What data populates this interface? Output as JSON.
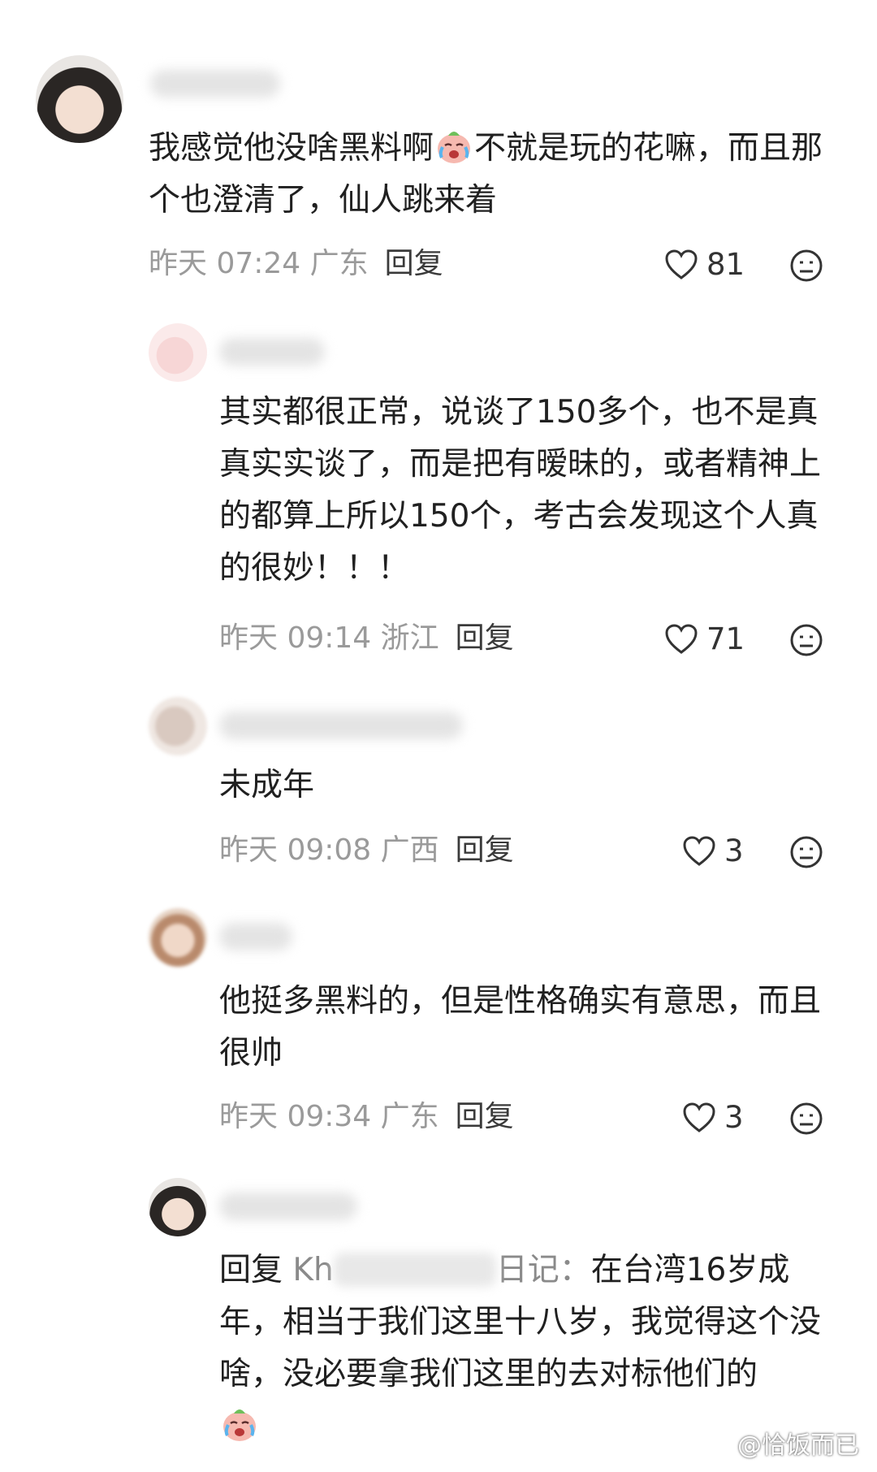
{
  "comments": [
    {
      "text_before": "我感觉他没啥黑料啊",
      "emoji_icon": "crying-laughing-emoji",
      "text_after": "不就是玩的花嘛，而且那个也澄清了，仙人跳来着",
      "meta": "昨天 07:24 广东",
      "reply_label": "回复",
      "likes": "81"
    },
    {
      "text": "其实都很正常，说谈了150多个，也不是真真实实谈了，而是把有暧昧的，或者精神上的都算上所以150个，考古会发现这个人真的很妙！！！",
      "meta": "昨天 09:14 浙江",
      "reply_label": "回复",
      "likes": "71"
    },
    {
      "text": "未成年",
      "meta": "昨天 09:08 广西",
      "reply_label": "回复",
      "likes": "3"
    },
    {
      "text": "他挺多黑料的，但是性格确实有意思，而且很帅",
      "meta": "昨天 09:34 广东",
      "reply_label": "回复",
      "likes": "3"
    },
    {
      "reply_prefix": "回复",
      "mention_visible": "Kh",
      "mention_tail": "日记：",
      "text": "在台湾16岁成年，相当于我们这里十八岁，我觉得这个没啥，没必要拿我们这里的去对标他们的",
      "emoji_icon": "crying-laughing-emoji"
    }
  ],
  "watermark": "@恰饭而已",
  "colors": {
    "meta_gray": "#9a9a9a",
    "text": "#202020",
    "mention_gray": "#8a8a8a"
  }
}
